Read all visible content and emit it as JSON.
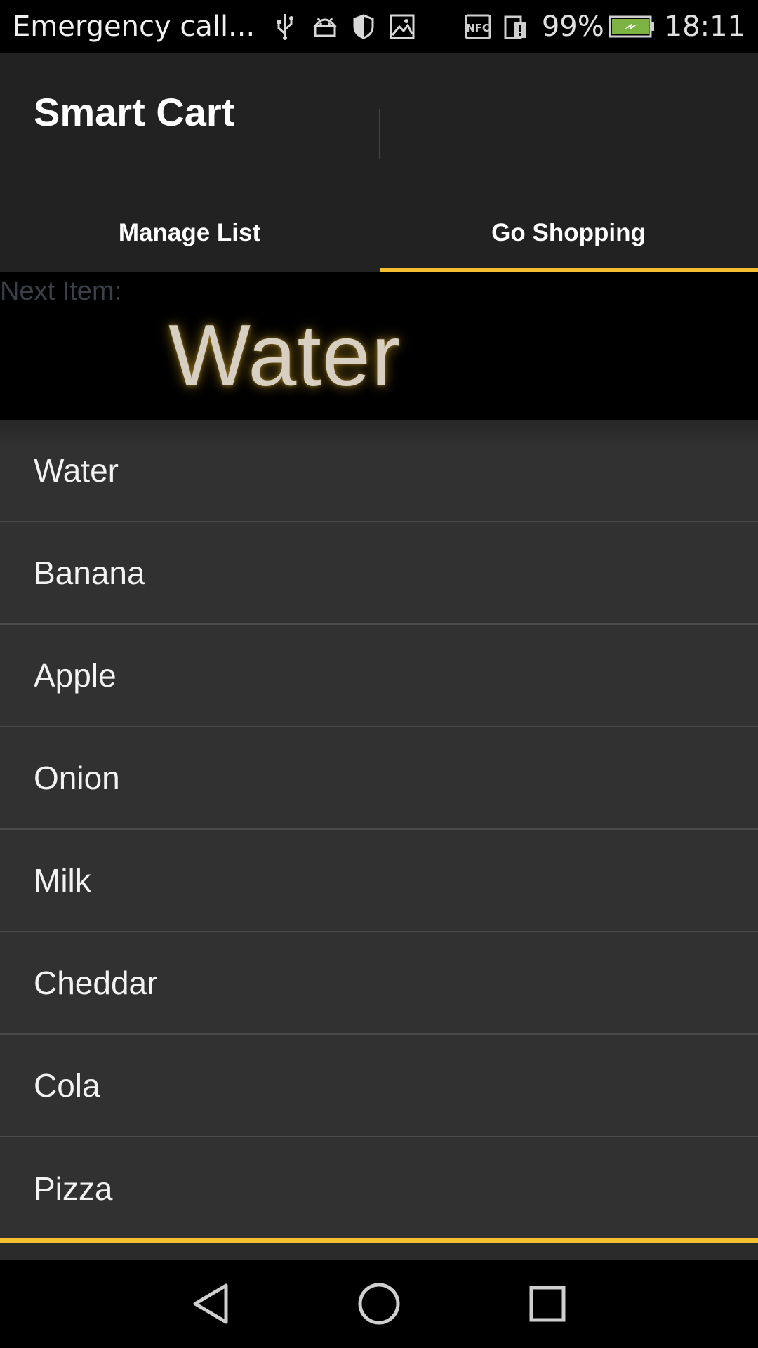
{
  "status_bar": {
    "carrier_text": "Emergency call...",
    "battery_percent": "99%",
    "time": "18:11",
    "icons": [
      "usb-icon",
      "android-debug-icon",
      "shield-icon",
      "image-icon",
      "nfc-icon",
      "sim-alert-icon",
      "battery-charging-icon"
    ]
  },
  "app": {
    "title": "Smart Cart",
    "tabs": [
      {
        "label": "Manage List",
        "active": false
      },
      {
        "label": "Go Shopping",
        "active": true
      }
    ],
    "accent_color": "#f5c02f"
  },
  "next_item": {
    "label": "Next Item:",
    "value": "Water"
  },
  "shopping_list": {
    "items": [
      "Water",
      "Banana",
      "Apple",
      "Onion",
      "Milk",
      "Cheddar",
      "Cola",
      "Pizza"
    ]
  },
  "nav_bar": {
    "buttons": [
      "back-icon",
      "home-icon",
      "recents-icon"
    ]
  }
}
